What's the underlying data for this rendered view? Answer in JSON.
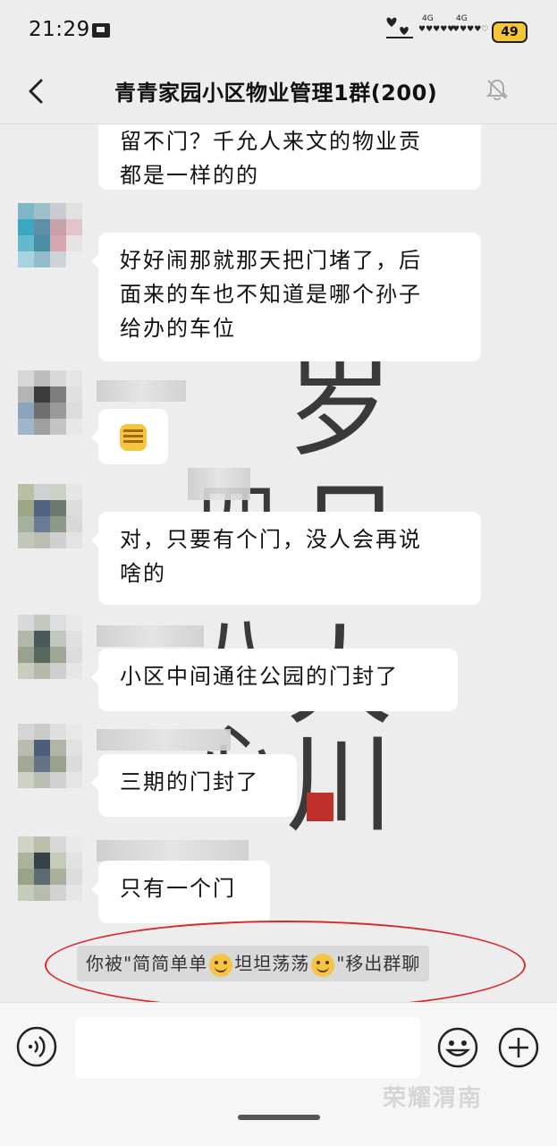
{
  "status_bar": {
    "time": "21:29",
    "signal_labels": [
      "4G",
      "4G"
    ],
    "battery": "49"
  },
  "header": {
    "title": "青青家园小区物业管理1群(200)"
  },
  "messages": [
    {
      "text": "留不门？千允人来文的物业贡\n都是一样的的"
    },
    {
      "text": "好好闹那就那天把门堵了，后\n面来的车也不知道是哪个孙子\n给办的车位"
    },
    {
      "text": ""
    },
    {
      "text": "对，只要有个门，没人会再说\n啥的"
    },
    {
      "text": "小区中间通往公园的门封了"
    },
    {
      "text": "三期的门封了"
    },
    {
      "text": "只有一个门"
    }
  ],
  "system_notice": {
    "prefix": "你被\"简简单单",
    "middle": "坦坦荡荡",
    "suffix": "\"移出群聊"
  },
  "watermark": "荣耀渭南"
}
